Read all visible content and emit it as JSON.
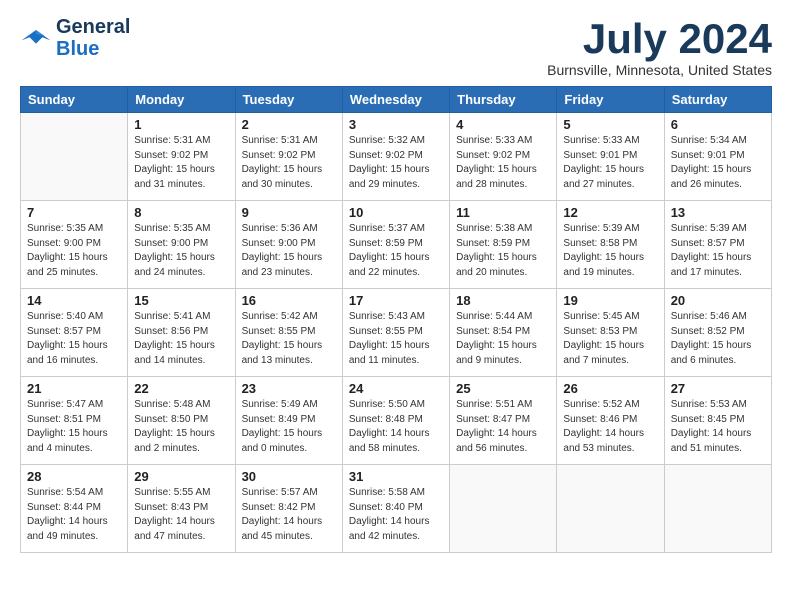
{
  "header": {
    "logo_line1": "General",
    "logo_line2": "Blue",
    "month_title": "July 2024",
    "location": "Burnsville, Minnesota, United States"
  },
  "weekdays": [
    "Sunday",
    "Monday",
    "Tuesday",
    "Wednesday",
    "Thursday",
    "Friday",
    "Saturday"
  ],
  "weeks": [
    [
      {
        "day": "",
        "info": ""
      },
      {
        "day": "1",
        "info": "Sunrise: 5:31 AM\nSunset: 9:02 PM\nDaylight: 15 hours\nand 31 minutes."
      },
      {
        "day": "2",
        "info": "Sunrise: 5:31 AM\nSunset: 9:02 PM\nDaylight: 15 hours\nand 30 minutes."
      },
      {
        "day": "3",
        "info": "Sunrise: 5:32 AM\nSunset: 9:02 PM\nDaylight: 15 hours\nand 29 minutes."
      },
      {
        "day": "4",
        "info": "Sunrise: 5:33 AM\nSunset: 9:02 PM\nDaylight: 15 hours\nand 28 minutes."
      },
      {
        "day": "5",
        "info": "Sunrise: 5:33 AM\nSunset: 9:01 PM\nDaylight: 15 hours\nand 27 minutes."
      },
      {
        "day": "6",
        "info": "Sunrise: 5:34 AM\nSunset: 9:01 PM\nDaylight: 15 hours\nand 26 minutes."
      }
    ],
    [
      {
        "day": "7",
        "info": "Sunrise: 5:35 AM\nSunset: 9:00 PM\nDaylight: 15 hours\nand 25 minutes."
      },
      {
        "day": "8",
        "info": "Sunrise: 5:35 AM\nSunset: 9:00 PM\nDaylight: 15 hours\nand 24 minutes."
      },
      {
        "day": "9",
        "info": "Sunrise: 5:36 AM\nSunset: 9:00 PM\nDaylight: 15 hours\nand 23 minutes."
      },
      {
        "day": "10",
        "info": "Sunrise: 5:37 AM\nSunset: 8:59 PM\nDaylight: 15 hours\nand 22 minutes."
      },
      {
        "day": "11",
        "info": "Sunrise: 5:38 AM\nSunset: 8:59 PM\nDaylight: 15 hours\nand 20 minutes."
      },
      {
        "day": "12",
        "info": "Sunrise: 5:39 AM\nSunset: 8:58 PM\nDaylight: 15 hours\nand 19 minutes."
      },
      {
        "day": "13",
        "info": "Sunrise: 5:39 AM\nSunset: 8:57 PM\nDaylight: 15 hours\nand 17 minutes."
      }
    ],
    [
      {
        "day": "14",
        "info": "Sunrise: 5:40 AM\nSunset: 8:57 PM\nDaylight: 15 hours\nand 16 minutes."
      },
      {
        "day": "15",
        "info": "Sunrise: 5:41 AM\nSunset: 8:56 PM\nDaylight: 15 hours\nand 14 minutes."
      },
      {
        "day": "16",
        "info": "Sunrise: 5:42 AM\nSunset: 8:55 PM\nDaylight: 15 hours\nand 13 minutes."
      },
      {
        "day": "17",
        "info": "Sunrise: 5:43 AM\nSunset: 8:55 PM\nDaylight: 15 hours\nand 11 minutes."
      },
      {
        "day": "18",
        "info": "Sunrise: 5:44 AM\nSunset: 8:54 PM\nDaylight: 15 hours\nand 9 minutes."
      },
      {
        "day": "19",
        "info": "Sunrise: 5:45 AM\nSunset: 8:53 PM\nDaylight: 15 hours\nand 7 minutes."
      },
      {
        "day": "20",
        "info": "Sunrise: 5:46 AM\nSunset: 8:52 PM\nDaylight: 15 hours\nand 6 minutes."
      }
    ],
    [
      {
        "day": "21",
        "info": "Sunrise: 5:47 AM\nSunset: 8:51 PM\nDaylight: 15 hours\nand 4 minutes."
      },
      {
        "day": "22",
        "info": "Sunrise: 5:48 AM\nSunset: 8:50 PM\nDaylight: 15 hours\nand 2 minutes."
      },
      {
        "day": "23",
        "info": "Sunrise: 5:49 AM\nSunset: 8:49 PM\nDaylight: 15 hours\nand 0 minutes."
      },
      {
        "day": "24",
        "info": "Sunrise: 5:50 AM\nSunset: 8:48 PM\nDaylight: 14 hours\nand 58 minutes."
      },
      {
        "day": "25",
        "info": "Sunrise: 5:51 AM\nSunset: 8:47 PM\nDaylight: 14 hours\nand 56 minutes."
      },
      {
        "day": "26",
        "info": "Sunrise: 5:52 AM\nSunset: 8:46 PM\nDaylight: 14 hours\nand 53 minutes."
      },
      {
        "day": "27",
        "info": "Sunrise: 5:53 AM\nSunset: 8:45 PM\nDaylight: 14 hours\nand 51 minutes."
      }
    ],
    [
      {
        "day": "28",
        "info": "Sunrise: 5:54 AM\nSunset: 8:44 PM\nDaylight: 14 hours\nand 49 minutes."
      },
      {
        "day": "29",
        "info": "Sunrise: 5:55 AM\nSunset: 8:43 PM\nDaylight: 14 hours\nand 47 minutes."
      },
      {
        "day": "30",
        "info": "Sunrise: 5:57 AM\nSunset: 8:42 PM\nDaylight: 14 hours\nand 45 minutes."
      },
      {
        "day": "31",
        "info": "Sunrise: 5:58 AM\nSunset: 8:40 PM\nDaylight: 14 hours\nand 42 minutes."
      },
      {
        "day": "",
        "info": ""
      },
      {
        "day": "",
        "info": ""
      },
      {
        "day": "",
        "info": ""
      }
    ]
  ]
}
